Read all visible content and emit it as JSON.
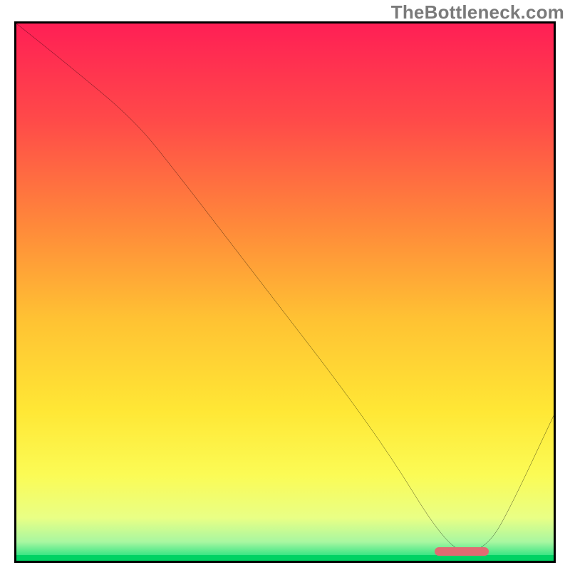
{
  "watermark": "TheBottleneck.com",
  "chart_data": {
    "type": "line",
    "title": "",
    "xlabel": "",
    "ylabel": "",
    "xlim": [
      0,
      100
    ],
    "ylim": [
      0,
      100
    ],
    "grid": false,
    "legend": false,
    "series": [
      {
        "name": "bottleneck-curve",
        "x": [
          0,
          10,
          22,
          30,
          40,
          50,
          60,
          70,
          78,
          83,
          88,
          92,
          100
        ],
        "y": [
          100,
          92,
          82,
          72,
          59,
          46,
          33,
          19,
          6,
          1,
          3,
          10,
          27
        ]
      }
    ],
    "marker": {
      "name": "optimal-range",
      "x_start": 78,
      "x_end": 88,
      "y": 0.7,
      "color": "#e16b72"
    },
    "background_gradient": {
      "stops": [
        {
          "pos": 0.0,
          "color": "#ff1f55"
        },
        {
          "pos": 0.18,
          "color": "#ff4a49"
        },
        {
          "pos": 0.38,
          "color": "#ff8a3a"
        },
        {
          "pos": 0.55,
          "color": "#ffc233"
        },
        {
          "pos": 0.72,
          "color": "#ffe735"
        },
        {
          "pos": 0.84,
          "color": "#fbfb55"
        },
        {
          "pos": 0.92,
          "color": "#e9ff85"
        },
        {
          "pos": 0.965,
          "color": "#a8f7a1"
        },
        {
          "pos": 0.99,
          "color": "#38e584"
        },
        {
          "pos": 1.0,
          "color": "#00d264"
        }
      ]
    }
  }
}
